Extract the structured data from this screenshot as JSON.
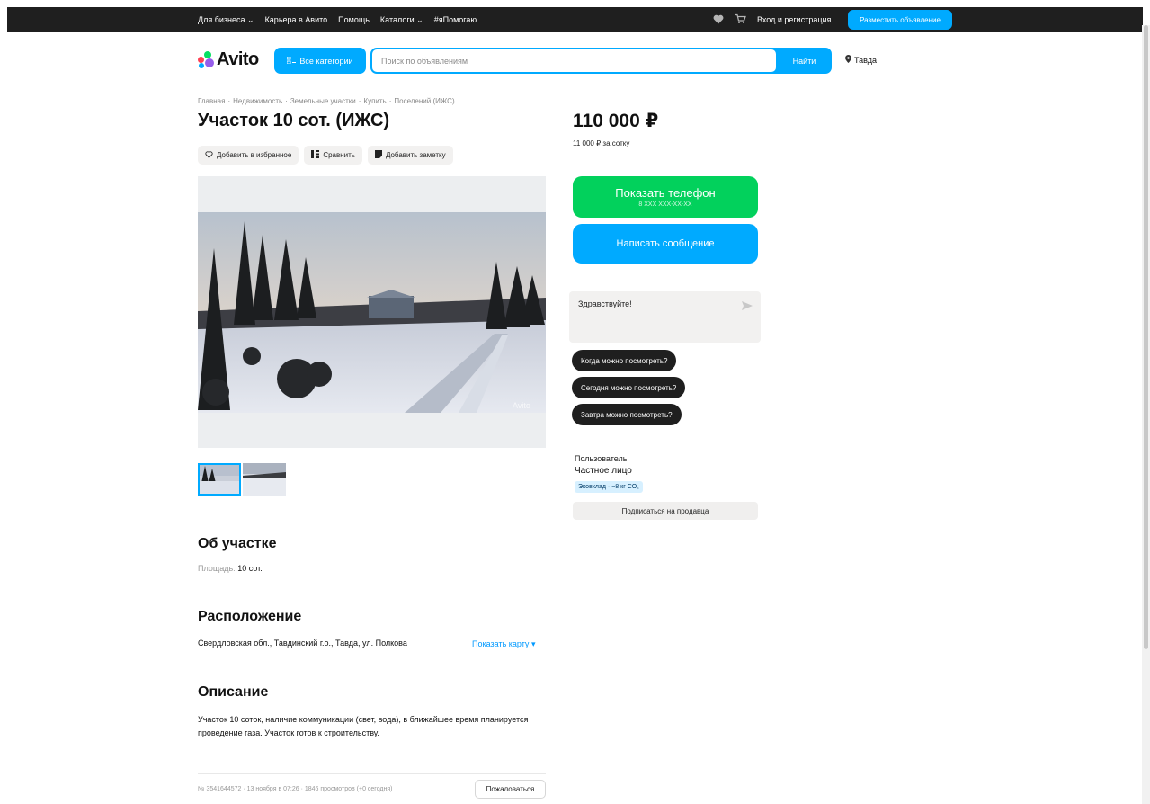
{
  "topbar": {
    "nav": [
      {
        "label": "Для бизнеса",
        "dropdown": true
      },
      {
        "label": "Карьера в Авито",
        "dropdown": false
      },
      {
        "label": "Помощь",
        "dropdown": false
      },
      {
        "label": "Каталоги",
        "dropdown": true
      },
      {
        "label": "#яПомогаю",
        "dropdown": false
      }
    ],
    "login_label": "Вход и регистрация",
    "post_ad_label": "Разместить объявление",
    "icons": [
      "heart-icon",
      "cart-icon"
    ]
  },
  "header": {
    "logo_text": "Avito",
    "all_categories_label": "Все категории",
    "search_placeholder": "Поиск по объявлениям",
    "search_button_label": "Найти",
    "location": "Тавда"
  },
  "breadcrumbs": [
    "Главная",
    "Недвижимость",
    "Земельные участки",
    "Купить",
    "Поселений (ИЖС)"
  ],
  "listing": {
    "title": "Участок 10 сот. (ИЖС)",
    "actions": [
      {
        "name": "favorite",
        "label": "Добавить в избранное",
        "icon": "heart-outline-icon"
      },
      {
        "name": "compare",
        "label": "Сравнить",
        "icon": "compare-icon"
      },
      {
        "name": "note",
        "label": "Добавить заметку",
        "icon": "note-icon"
      }
    ],
    "watermark": "Avito",
    "about": {
      "heading": "Об участке",
      "area_key": "Площадь:",
      "area_value": "10 сот."
    },
    "location": {
      "heading": "Расположение",
      "address": "Свердловская обл., Тавдинский г.о., Тавда, ул. Полкова",
      "show_map_label": "Показать карту"
    },
    "description": {
      "heading": "Описание",
      "text": "Участок 10 соток, наличие коммуникации (свет, вода), в ближайшее время планируется проведение газа. Участок готов к строительству."
    },
    "meta": "№ 3541644572 · 13 ноября в 07:26 · 1846 просмотров (+0 сегодня)",
    "complain_label": "Пожаловаться"
  },
  "sidebar": {
    "price": "110 000 ₽",
    "price_per_unit": "11 000 ₽ за сотку",
    "show_phone_label": "Показать телефон",
    "phone_mask": "8 XXX XXX-XX-XX",
    "write_message_label": "Написать сообщение",
    "message_draft": "Здравствуйте!",
    "quick_questions": [
      "Когда можно посмотреть?",
      "Сегодня можно посмотреть?",
      "Завтра можно посмотреть?"
    ],
    "seller": {
      "role": "Пользователь",
      "type": "Частное лицо",
      "eco_badge": "Эковклад · ~8 кг CO₂",
      "subscribe_label": "Подписаться на продавца"
    }
  },
  "colors": {
    "accent": "#00aaff",
    "phone_green": "#02d15c",
    "topbar_bg": "#1f1f1f",
    "chip_bg": "#f2f1f0"
  }
}
